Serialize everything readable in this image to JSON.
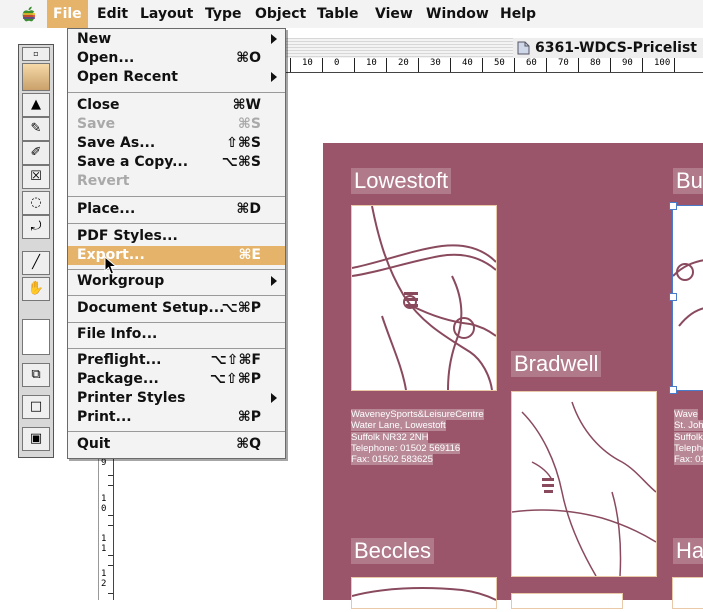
{
  "menubar": {
    "items": [
      {
        "label": "File",
        "active": true
      },
      {
        "label": "Edit"
      },
      {
        "label": "Layout"
      },
      {
        "label": "Type"
      },
      {
        "label": "Object"
      },
      {
        "label": "Table"
      },
      {
        "label": "View"
      },
      {
        "label": "Window"
      },
      {
        "label": "Help"
      }
    ]
  },
  "document": {
    "title": "6361-WDCS-Pricelist",
    "ruler_labels": [
      "10",
      "0",
      "10",
      "20",
      "30",
      "40",
      "50",
      "60",
      "70",
      "80",
      "90",
      "100"
    ],
    "vruler_labels": [
      "9",
      "1",
      "0",
      "1",
      "1",
      "1",
      "2"
    ]
  },
  "file_menu": {
    "groups": [
      [
        {
          "label": "New",
          "submenu": true
        },
        {
          "label": "Open...",
          "shortcut": "⌘O"
        },
        {
          "label": "Open Recent",
          "submenu": true
        }
      ],
      [
        {
          "label": "Close",
          "shortcut": "⌘W"
        },
        {
          "label": "Save",
          "shortcut": "⌘S",
          "disabled": true
        },
        {
          "label": "Save As...",
          "shortcut": "⇧⌘S"
        },
        {
          "label": "Save a Copy...",
          "shortcut": "⌥⌘S"
        },
        {
          "label": "Revert",
          "disabled": true
        }
      ],
      [
        {
          "label": "Place...",
          "shortcut": "⌘D"
        }
      ],
      [
        {
          "label": "PDF Styles..."
        },
        {
          "label": "Export...",
          "shortcut": "⌘E",
          "highlighted": true
        }
      ],
      [
        {
          "label": "Workgroup",
          "submenu": true
        }
      ],
      [
        {
          "label": "Document Setup...",
          "shortcut": "⌥⌘P"
        }
      ],
      [
        {
          "label": "File Info..."
        }
      ],
      [
        {
          "label": "Preflight...",
          "shortcut": "⌥⇧⌘F"
        },
        {
          "label": "Package...",
          "shortcut": "⌥⇧⌘P"
        },
        {
          "label": "Printer Styles",
          "submenu": true
        },
        {
          "label": "Print...",
          "shortcut": "⌘P"
        }
      ],
      [
        {
          "label": "Quit",
          "shortcut": "⌘Q"
        }
      ]
    ]
  },
  "page": {
    "headings": {
      "lowestoft": "Lowestoft",
      "bradwell": "Bradwell",
      "beccles": "Beccles",
      "right_top": "Bu",
      "right_bottom": "Ha"
    },
    "lowestoft_address": [
      "WaveneySports&LeisureCentre",
      "Water Lane, Lowestoft",
      "Suffolk NR32 2NH",
      "Telephone: 01502 569116",
      "Fax: 01502 583625"
    ],
    "right_address": [
      "Wave",
      "St. Joh",
      "Suffolk",
      "Telepho",
      "Fax: 01"
    ]
  },
  "colors": {
    "menu_highlight": "#e5b46a",
    "page_background": "#9a556b",
    "map_line": "#8a4a5e"
  },
  "icons": {
    "apple": "apple-logo-icon",
    "cursor": "arrow-cursor-icon",
    "document": "document-icon"
  }
}
